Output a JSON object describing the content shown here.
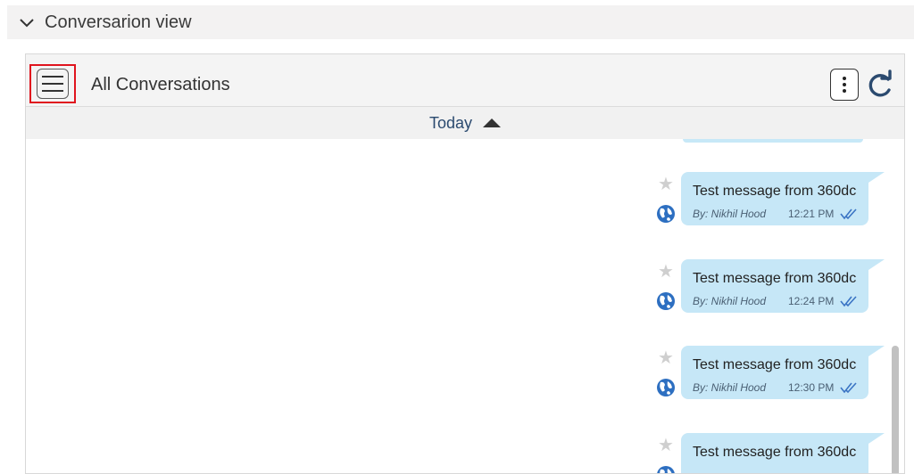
{
  "section": {
    "title": "Conversarion view",
    "toggle_icon": "chevron-down-icon"
  },
  "toolbar": {
    "title": "All Conversations",
    "menu_icon": "hamburger-icon",
    "more_icon": "kebab-icon",
    "refresh_icon": "refresh-icon"
  },
  "day_header": {
    "label": "Today",
    "toggle_icon": "caret-up-icon"
  },
  "messages": [
    {
      "text": "Test message from 360dc",
      "author": "By: Nikhil Hood",
      "time": "12:21 PM"
    },
    {
      "text": "Test message from 360dc",
      "author": "By: Nikhil Hood",
      "time": "12:24 PM"
    },
    {
      "text": "Test message from 360dc",
      "author": "By: Nikhil Hood",
      "time": "12:30 PM"
    },
    {
      "text": "Test message from 360dc",
      "author": "",
      "time": ""
    }
  ],
  "colors": {
    "bubble": "#c6e7f7",
    "accent": "#2b4a6f",
    "highlight_border": "#e0141e",
    "read_check": "#3a74c4"
  }
}
